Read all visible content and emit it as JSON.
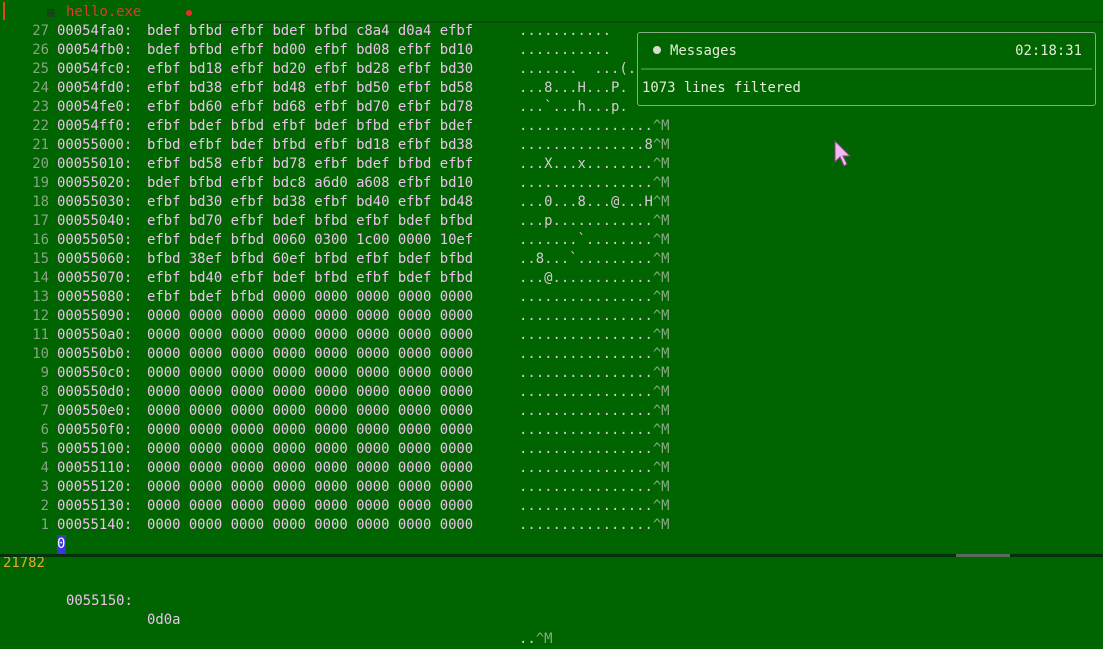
{
  "tab": {
    "title": "hello.exe",
    "file_icon": "file-icon",
    "modified_icon": "dot-icon"
  },
  "rows": [
    {
      "ln": "27",
      "addr": "00054fa0:",
      "hex": "bdef bfbd efbf bdef bfbd c8a4 d0a4 efbf",
      "ascii": "...........",
      "eol": ""
    },
    {
      "ln": "26",
      "addr": "00054fb0:",
      "hex": "bdef bfbd efbf bd00 efbf bd08 efbf bd10",
      "ascii": "...........",
      "eol": ""
    },
    {
      "ln": "25",
      "addr": "00054fc0:",
      "hex": "efbf bd18 efbf bd20 efbf bd28 efbf bd30",
      "ascii": ".......  ...(.",
      "eol": ""
    },
    {
      "ln": "24",
      "addr": "00054fd0:",
      "hex": "efbf bd38 efbf bd48 efbf bd50 efbf bd58",
      "ascii": "...8...H...P.",
      "eol": ""
    },
    {
      "ln": "23",
      "addr": "00054fe0:",
      "hex": "efbf bd60 efbf bd68 efbf bd70 efbf bd78",
      "ascii": "...`...h...p.",
      "eol": ""
    },
    {
      "ln": "22",
      "addr": "00054ff0:",
      "hex": "efbf bdef bfbd efbf bdef bfbd efbf bdef",
      "ascii": "................",
      "eol": "^M"
    },
    {
      "ln": "21",
      "addr": "00055000:",
      "hex": "bfbd efbf bdef bfbd efbf bd18 efbf bd38",
      "ascii": "...............8",
      "eol": "^M"
    },
    {
      "ln": "20",
      "addr": "00055010:",
      "hex": "efbf bd58 efbf bd78 efbf bdef bfbd efbf",
      "ascii": "...X...x........",
      "eol": "^M"
    },
    {
      "ln": "19",
      "addr": "00055020:",
      "hex": "bdef bfbd efbf bdc8 a6d0 a608 efbf bd10",
      "ascii": "................",
      "eol": "^M"
    },
    {
      "ln": "18",
      "addr": "00055030:",
      "hex": "efbf bd30 efbf bd38 efbf bd40 efbf bd48",
      "ascii": "...0...8...@...H",
      "eol": "^M"
    },
    {
      "ln": "17",
      "addr": "00055040:",
      "hex": "efbf bd70 efbf bdef bfbd efbf bdef bfbd",
      "ascii": "...p............",
      "eol": "^M"
    },
    {
      "ln": "16",
      "addr": "00055050:",
      "hex": "efbf bdef bfbd 0060 0300 1c00 0000 10ef",
      "ascii": ".......`........",
      "eol": "^M"
    },
    {
      "ln": "15",
      "addr": "00055060:",
      "hex": "bfbd 38ef bfbd 60ef bfbd efbf bdef bfbd",
      "ascii": "..8...`.........",
      "eol": "^M"
    },
    {
      "ln": "14",
      "addr": "00055070:",
      "hex": "efbf bd40 efbf bdef bfbd efbf bdef bfbd",
      "ascii": "...@............",
      "eol": "^M"
    },
    {
      "ln": "13",
      "addr": "00055080:",
      "hex": "efbf bdef bfbd 0000 0000 0000 0000 0000",
      "ascii": "................",
      "eol": "^M"
    },
    {
      "ln": "12",
      "addr": "00055090:",
      "hex": "0000 0000 0000 0000 0000 0000 0000 0000",
      "ascii": "................",
      "eol": "^M"
    },
    {
      "ln": "11",
      "addr": "000550a0:",
      "hex": "0000 0000 0000 0000 0000 0000 0000 0000",
      "ascii": "................",
      "eol": "^M"
    },
    {
      "ln": "10",
      "addr": "000550b0:",
      "hex": "0000 0000 0000 0000 0000 0000 0000 0000",
      "ascii": "................",
      "eol": "^M"
    },
    {
      "ln": "9",
      "addr": "000550c0:",
      "hex": "0000 0000 0000 0000 0000 0000 0000 0000",
      "ascii": "................",
      "eol": "^M"
    },
    {
      "ln": "8",
      "addr": "000550d0:",
      "hex": "0000 0000 0000 0000 0000 0000 0000 0000",
      "ascii": "................",
      "eol": "^M"
    },
    {
      "ln": "7",
      "addr": "000550e0:",
      "hex": "0000 0000 0000 0000 0000 0000 0000 0000",
      "ascii": "................",
      "eol": "^M"
    },
    {
      "ln": "6",
      "addr": "000550f0:",
      "hex": "0000 0000 0000 0000 0000 0000 0000 0000",
      "ascii": "................",
      "eol": "^M"
    },
    {
      "ln": "5",
      "addr": "00055100:",
      "hex": "0000 0000 0000 0000 0000 0000 0000 0000",
      "ascii": "................",
      "eol": "^M"
    },
    {
      "ln": "4",
      "addr": "00055110:",
      "hex": "0000 0000 0000 0000 0000 0000 0000 0000",
      "ascii": "................",
      "eol": "^M"
    },
    {
      "ln": "3",
      "addr": "00055120:",
      "hex": "0000 0000 0000 0000 0000 0000 0000 0000",
      "ascii": "................",
      "eol": "^M"
    },
    {
      "ln": "2",
      "addr": "00055130:",
      "hex": "0000 0000 0000 0000 0000 0000 0000 0000",
      "ascii": "................",
      "eol": "^M"
    },
    {
      "ln": "1",
      "addr": "00055140:",
      "hex": "0000 0000 0000 0000 0000 0000 0000 0000",
      "ascii": "................",
      "eol": "^M"
    }
  ],
  "current_line": {
    "ln": "21782",
    "cursor_char": "0",
    "addr": "0055150:",
    "hex": "0d0a",
    "ascii": "..",
    "eol": "^M"
  },
  "messages": {
    "icon": "info-icon",
    "title": "Messages",
    "time": "02:18:31",
    "body": "1073 lines filtered"
  },
  "colors": {
    "background": "#006400",
    "hex_text": "#ecc3ea",
    "line_numbers": "#86a683",
    "current_line_number": "#e6a832",
    "cursor": "#3a36d8",
    "tab_title": "#e3382c"
  }
}
